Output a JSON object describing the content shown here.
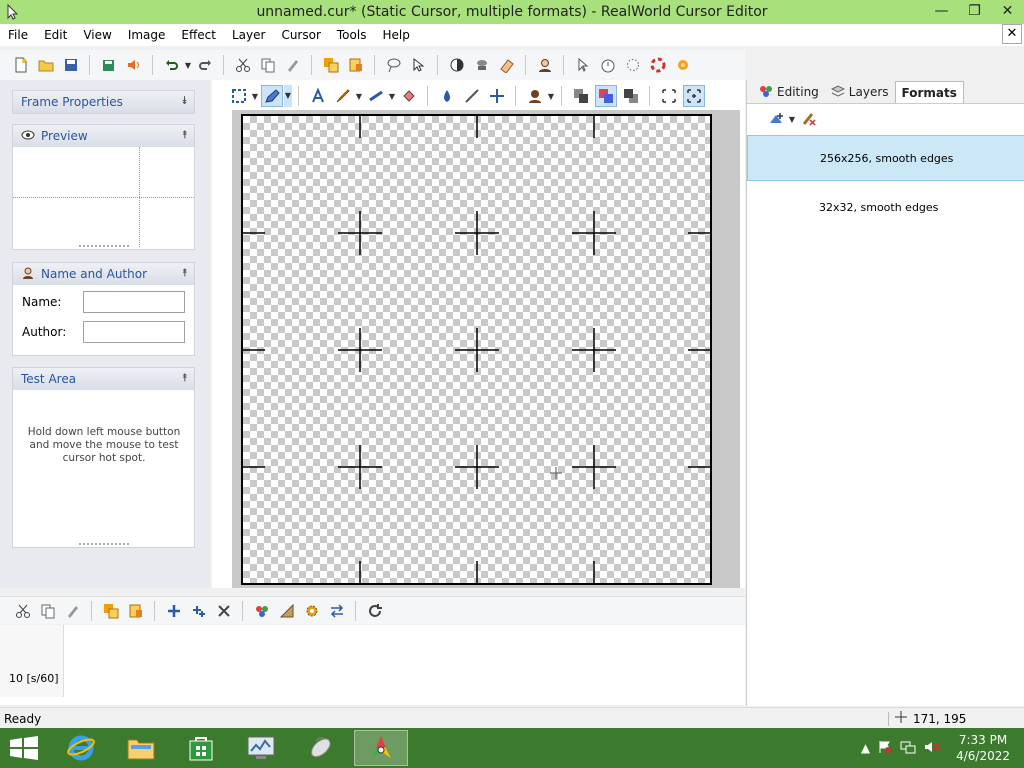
{
  "window": {
    "title": "unnamed.cur* (Static Cursor, multiple formats) - RealWorld Cursor Editor",
    "controls": {
      "minimize": "—",
      "maximize": "❐",
      "close": "✕"
    }
  },
  "menu": [
    "File",
    "Edit",
    "View",
    "Image",
    "Effect",
    "Layer",
    "Cursor",
    "Tools",
    "Help"
  ],
  "menu_close": "✕",
  "left_panels": {
    "frame_properties": {
      "title": "Frame Properties"
    },
    "preview": {
      "title": "Preview"
    },
    "name_author": {
      "title": "Name and Author",
      "name_label": "Name:",
      "name_value": "",
      "author_label": "Author:",
      "author_value": ""
    },
    "test_area": {
      "title": "Test Area",
      "hint": "Hold down left mouse button and move the mouse to test cursor hot spot."
    }
  },
  "right_panel": {
    "tabs": [
      {
        "label": "Editing"
      },
      {
        "label": "Layers"
      },
      {
        "label": "Formats"
      }
    ],
    "active_tab": "Formats",
    "formats": [
      {
        "label": "256x256, smooth edges",
        "selected": true
      },
      {
        "label": "32x32, smooth edges",
        "selected": false
      }
    ]
  },
  "frames": {
    "thumb_label": "10 [s/60]"
  },
  "status": {
    "text": "Ready",
    "coords": "171, 195"
  },
  "taskbar": {
    "clock_time": "7:33 PM",
    "clock_date": "4/6/2022"
  },
  "colors": {
    "title_bar": "#a8e07c",
    "taskbar": "#3c7a2e",
    "selection": "#cce8f6",
    "panel_header_text": "#2a54a0"
  }
}
